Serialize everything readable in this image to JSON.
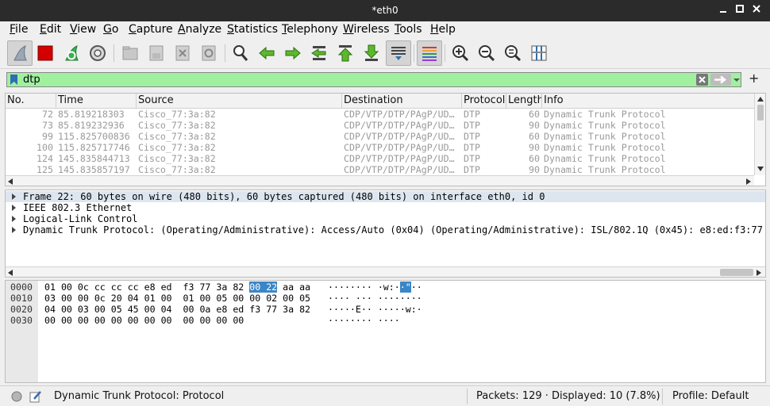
{
  "window": {
    "title": "*eth0",
    "controls": [
      "minimize-icon",
      "maximize-icon",
      "close-icon"
    ]
  },
  "menu": [
    {
      "label": "File",
      "mnemonic": "F",
      "rest": "ile"
    },
    {
      "label": "Edit",
      "mnemonic": "E",
      "rest": "dit"
    },
    {
      "label": "View",
      "mnemonic": "V",
      "rest": "iew"
    },
    {
      "label": "Go",
      "mnemonic": "G",
      "rest": "o"
    },
    {
      "label": "Capture",
      "mnemonic": "C",
      "rest": "apture"
    },
    {
      "label": "Analyze",
      "mnemonic": "A",
      "rest": "nalyze"
    },
    {
      "label": "Statistics",
      "mnemonic": "S",
      "rest": "tatistics"
    },
    {
      "label": "Telephony",
      "mnemonic": "T",
      "rest": "elephony"
    },
    {
      "label": "Wireless",
      "mnemonic": "W",
      "rest": "ireless"
    },
    {
      "label": "Tools",
      "mnemonic": "T",
      "rest": "ools"
    },
    {
      "label": "Help",
      "mnemonic": "H",
      "rest": "elp"
    }
  ],
  "toolbar": {
    "icons": [
      "shark-fin-start-icon",
      "stop-capture-icon",
      "restart-capture-icon",
      "capture-options-gear-icon",
      "open-file-icon",
      "save-file-icon",
      "close-file-icon",
      "reload-file-icon",
      "find-packet-icon",
      "go-back-icon",
      "go-forward-icon",
      "go-to-packet-icon",
      "go-first-icon",
      "go-last-icon",
      "auto-scroll-icon",
      "colorize-icon",
      "zoom-in-icon",
      "zoom-out-icon",
      "zoom-normal-icon",
      "resize-columns-icon"
    ]
  },
  "filter": {
    "value": "dtp",
    "add_label": "+"
  },
  "packet_list": {
    "columns": [
      "No.",
      "Time",
      "Source",
      "Destination",
      "Protocol",
      "Length",
      "Info"
    ],
    "rows": [
      {
        "no": "72",
        "time": "85.819218303",
        "source": "Cisco_77:3a:82",
        "destination": "CDP/VTP/DTP/PAgP/UD…",
        "protocol": "DTP",
        "length": "60",
        "info": "Dynamic Trunk Protocol"
      },
      {
        "no": "73",
        "time": "85.819232936",
        "source": "Cisco_77:3a:82",
        "destination": "CDP/VTP/DTP/PAgP/UD…",
        "protocol": "DTP",
        "length": "90",
        "info": "Dynamic Trunk Protocol"
      },
      {
        "no": "99",
        "time": "115.825700836",
        "source": "Cisco_77:3a:82",
        "destination": "CDP/VTP/DTP/PAgP/UD…",
        "protocol": "DTP",
        "length": "60",
        "info": "Dynamic Trunk Protocol"
      },
      {
        "no": "100",
        "time": "115.825717746",
        "source": "Cisco_77:3a:82",
        "destination": "CDP/VTP/DTP/PAgP/UD…",
        "protocol": "DTP",
        "length": "90",
        "info": "Dynamic Trunk Protocol"
      },
      {
        "no": "124",
        "time": "145.835844713",
        "source": "Cisco_77:3a:82",
        "destination": "CDP/VTP/DTP/PAgP/UD…",
        "protocol": "DTP",
        "length": "60",
        "info": "Dynamic Trunk Protocol"
      },
      {
        "no": "125",
        "time": "145.835857197",
        "source": "Cisco_77:3a:82",
        "destination": "CDP/VTP/DTP/PAgP/UD…",
        "protocol": "DTP",
        "length": "90",
        "info": "Dynamic Trunk Protocol"
      }
    ]
  },
  "details": [
    "Frame 22: 60 bytes on wire (480 bits), 60 bytes captured (480 bits) on interface eth0, id 0",
    "IEEE 802.3 Ethernet",
    "Logical-Link Control",
    "Dynamic Trunk Protocol:  (Operating/Administrative): Access/Auto (0x04) (Operating/Administrative): ISL/802.1Q (0x45): e8:ed:f3:77"
  ],
  "bytes": [
    {
      "offset": "0000",
      "hex_a": "01 00 0c cc cc cc e8 ed  f3 77 3a 82 ",
      "hex_hl": "00 22",
      "hex_b": " aa aa",
      "ascii_a": "········ ·w:·",
      "ascii_hl": "·\"",
      "ascii_b": "··"
    },
    {
      "offset": "0010",
      "hex_a": "03 00 00 0c 20 04 01 00  01 00 05 00 00 02 00 05",
      "hex_hl": "",
      "hex_b": "",
      "ascii_a": "···· ··· ········",
      "ascii_hl": "",
      "ascii_b": ""
    },
    {
      "offset": "0020",
      "hex_a": "04 00 03 00 05 45 00 04  00 0a e8 ed f3 77 3a 82",
      "hex_hl": "",
      "hex_b": "",
      "ascii_a": "·····E·· ·····w:·",
      "ascii_hl": "",
      "ascii_b": ""
    },
    {
      "offset": "0030",
      "hex_a": "00 00 00 00 00 00 00 00  00 00 00 00",
      "hex_hl": "",
      "hex_b": "",
      "ascii_a": "········ ····",
      "ascii_hl": "",
      "ascii_b": ""
    }
  ],
  "status": {
    "field": "Dynamic Trunk Protocol: Protocol",
    "packets": "Packets: 129 · Displayed: 10 (7.8%)",
    "profile": "Profile: Default"
  },
  "colors": {
    "filter_valid": "#a0f0a0",
    "byte_highlight": "#3a86c8",
    "titlebar": "#2b2b2b"
  }
}
